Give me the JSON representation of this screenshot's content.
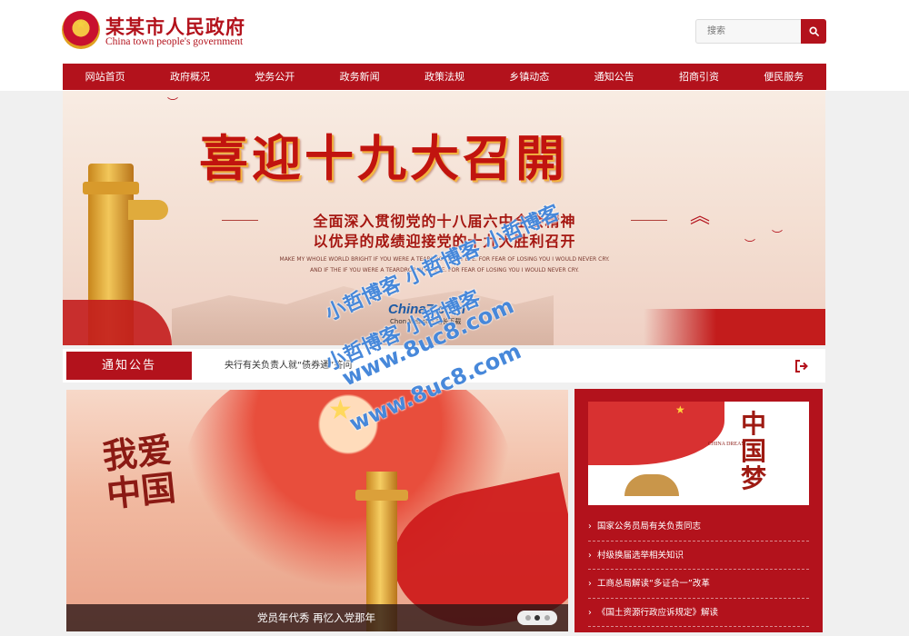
{
  "header": {
    "site_title_cn": "某某市人民政府",
    "site_title_en": "China town people's government",
    "search_placeholder": "搜索"
  },
  "nav": {
    "items": [
      "网站首页",
      "政府概况",
      "党务公开",
      "政务新闻",
      "政策法规",
      "乡镇动态",
      "通知公告",
      "招商引资",
      "便民服务"
    ]
  },
  "banner": {
    "headline": "喜迎十九大召開",
    "line1": "全面深入贯彻党的十八届六中全会精神",
    "line2": "以优异的成绩迎接党的十九大胜利召开",
    "en_line1": "MAKE MY WHOLE WORLD BRIGHT IF YOU WERE A TEARDROP IN MY EYE. FOR FEAR OF LOSING YOU I WOULD NEVER CRY.",
    "en_line2": "AND IF THE IF YOU WERE A TEARDROP IN MY EYE. FOR FEAR OF LOSING YOU I WOULD NEVER CRY.",
    "logo_text": "China7.com",
    "logo_sub": "Chon Website 站长下载"
  },
  "notice": {
    "label": "通知公告",
    "text": "央行有关负责人就“债券通”答问"
  },
  "slideshow": {
    "art_text": "我爱中国",
    "caption": "党员年代秀 再忆入党那年",
    "dot_count": 3,
    "active_index": 1
  },
  "panel": {
    "image_text": "中国梦",
    "image_en": "CHINA DREAM",
    "items": [
      "国家公务员局有关负责同志",
      "村级换届选举相关知识",
      "工商总局解读“多证合一”改革",
      "《国土资源行政应诉规定》解读"
    ]
  },
  "watermark": {
    "lines": [
      "小哲博客 小哲博客 小哲博客",
      "小哲博客 小哲博客",
      "www.8uc8.com",
      "www.8uc8.com"
    ]
  },
  "colors": {
    "primary": "#b3121c",
    "watermark": "#1e6ed2"
  }
}
